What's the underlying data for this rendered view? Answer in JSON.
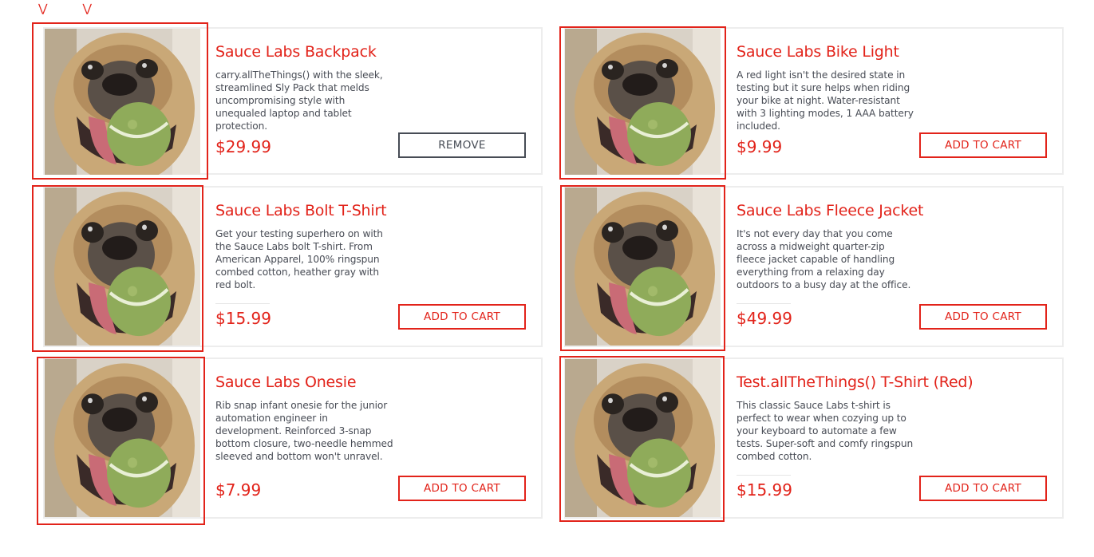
{
  "products": [
    {
      "name": "Sauce Labs Backpack",
      "description": "carry.allTheThings() with the sleek, streamlined Sly Pack that melds uncompromising style with unequaled laptop and tablet protection.",
      "price": "$29.99",
      "button_label": "REMOVE",
      "image_alt": "pug with tennis ball"
    },
    {
      "name": "Sauce Labs Bike Light",
      "description": "A red light isn't the desired state in testing but it sure helps when riding your bike at night. Water-resistant with 3 lighting modes, 1 AAA battery included.",
      "price": "$9.99",
      "button_label": "ADD TO CART",
      "image_alt": "pug with tennis ball"
    },
    {
      "name": "Sauce Labs Bolt T-Shirt",
      "description": "Get your testing superhero on with the Sauce Labs bolt T-shirt. From American Apparel, 100% ringspun combed cotton, heather gray with red bolt.",
      "price": "$15.99",
      "button_label": "ADD TO CART",
      "image_alt": "pug with tennis ball"
    },
    {
      "name": "Sauce Labs Fleece Jacket",
      "description": "It's not every day that you come across a midweight quarter-zip fleece jacket capable of handling everything from a relaxing day outdoors to a busy day at the office.",
      "price": "$49.99",
      "button_label": "ADD TO CART",
      "image_alt": "pug with tennis ball"
    },
    {
      "name": "Sauce Labs Onesie",
      "description": "Rib snap infant onesie for the junior automation engineer in development. Reinforced 3-snap bottom closure, two-needle hemmed sleeved and bottom won't unravel.",
      "price": "$7.99",
      "button_label": "ADD TO CART",
      "image_alt": "pug with tennis ball"
    },
    {
      "name": "Test.allTheThings() T-Shirt (Red)",
      "description": "This classic Sauce Labs t-shirt is perfect to wear when cozying up to your keyboard to automate a few tests. Super-soft and comfy ringspun combed cotton.",
      "price": "$15.99",
      "button_label": "ADD TO CART",
      "image_alt": "pug with tennis ball"
    }
  ],
  "colors": {
    "accent": "#e2231a",
    "text": "#484c55",
    "remove": "#474c55",
    "border": "#ededed"
  }
}
